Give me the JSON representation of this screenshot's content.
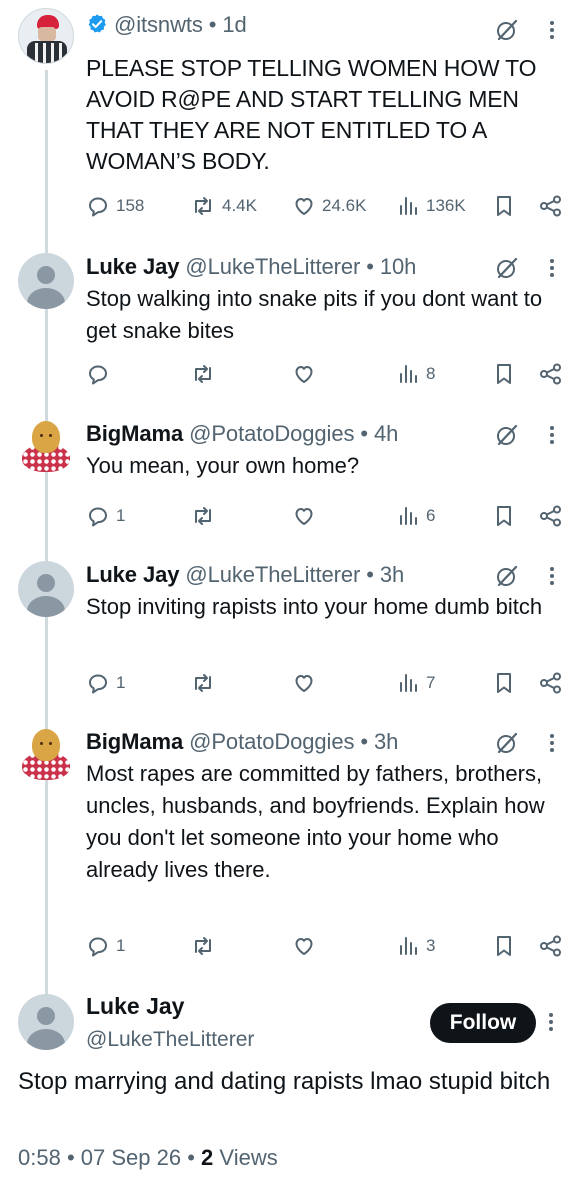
{
  "thread": [
    {
      "handle": "@itsnwts",
      "time": "1d",
      "verified": true,
      "text": "PLEASE STOP TELLING WOMEN HOW TO AVOID R@PE AND START TELLING MEN THAT THEY ARE NOT ENTITLED TO A WOMAN’S BODY.",
      "stats": {
        "replies": "158",
        "reposts": "4.4K",
        "likes": "24.6K",
        "views": "136K"
      }
    },
    {
      "name": "Luke Jay",
      "handle": "@LukeTheLitterer",
      "time": "10h",
      "text": "Stop walking into snake pits if you dont want to get snake bites",
      "stats": {
        "replies": "",
        "reposts": "",
        "likes": "",
        "views": "8"
      }
    },
    {
      "name": "BigMama",
      "handle": "@PotatoDoggies",
      "time": "4h",
      "text": "You mean, your own home?",
      "stats": {
        "replies": "1",
        "reposts": "",
        "likes": "",
        "views": "6"
      }
    },
    {
      "name": "Luke Jay",
      "handle": "@LukeTheLitterer",
      "time": "3h",
      "text": "Stop inviting rapists into your home dumb bitch",
      "stats": {
        "replies": "1",
        "reposts": "",
        "likes": "",
        "views": "7"
      }
    },
    {
      "name": "BigMama",
      "handle": "@PotatoDoggies",
      "time": "3h",
      "text": "Most rapes are committed by fathers, brothers, uncles, husbands, and boyfriends. Explain how you don't let someone into your home who already lives there.",
      "stats": {
        "replies": "1",
        "reposts": "",
        "likes": "",
        "views": "3"
      }
    }
  ],
  "focus": {
    "name": "Luke Jay",
    "handle": "@LukeTheLitterer",
    "follow_label": "Follow",
    "text": "Stop marrying and dating rapists lmao stupid bitch",
    "time": "0:58",
    "date": "07 Sep 26",
    "views_count": "2",
    "views_label": "Views"
  },
  "separator": "•",
  "colors": {
    "text": "#0f1419",
    "secondary": "#536471",
    "verified": "#1d9bf0",
    "thread_line": "#cfd9de",
    "button": "#0f1419"
  },
  "icons": [
    "verified-badge-icon",
    "grok-icon",
    "more-icon",
    "reply-icon",
    "repost-icon",
    "like-icon",
    "views-icon",
    "bookmark-icon",
    "share-icon"
  ]
}
